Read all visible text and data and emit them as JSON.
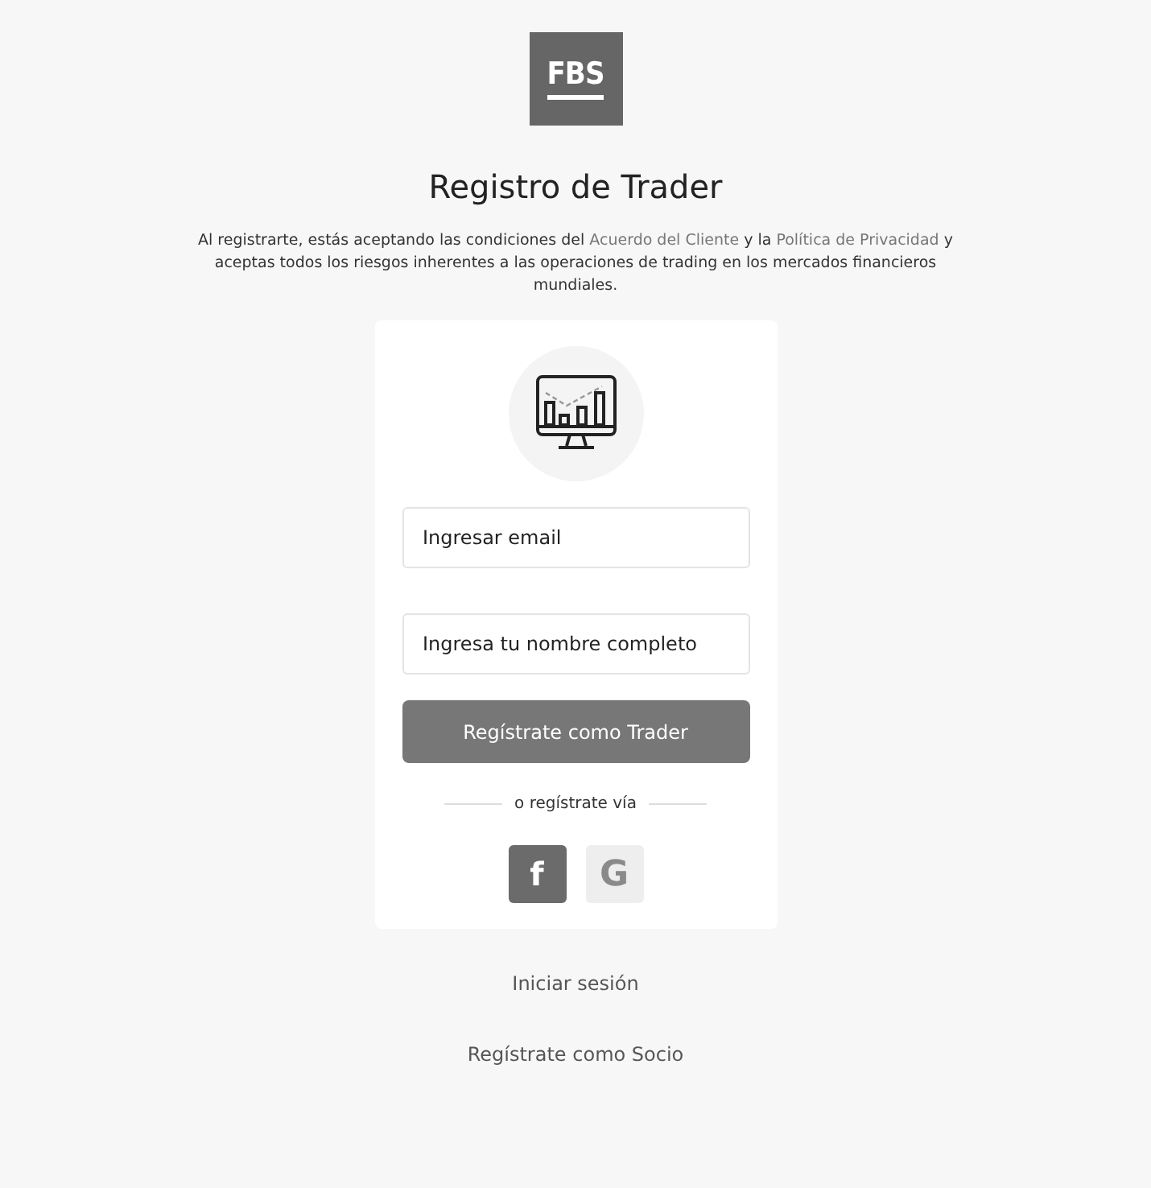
{
  "logo": {
    "text": "FBS"
  },
  "title": "Registro de Trader",
  "intro": [
    {
      "kind": "text",
      "text": "Al registrarte, estás aceptando las condiciones del "
    },
    {
      "kind": "link",
      "text": "Acuerdo del Cliente"
    },
    {
      "kind": "text",
      "text": " y la "
    },
    {
      "kind": "link",
      "text": "Política de Privacidad"
    },
    {
      "kind": "text",
      "text": " y aceptas todos los riesgos inherentes a las operaciones de trading en los mercados financieros mundiales."
    }
  ],
  "form": {
    "fields": [
      {
        "placeholder": "Ingresar email"
      },
      {
        "placeholder": "Ingresa tu nombre completo"
      }
    ],
    "submit": "Regístrate como Trader",
    "divider": "o regístrate vía",
    "social": [
      {
        "kind": "facebook",
        "letter": "f"
      },
      {
        "kind": "google",
        "letter": "G"
      }
    ]
  },
  "links": [
    "Iniciar sesión",
    "Regístrate como Socio"
  ]
}
